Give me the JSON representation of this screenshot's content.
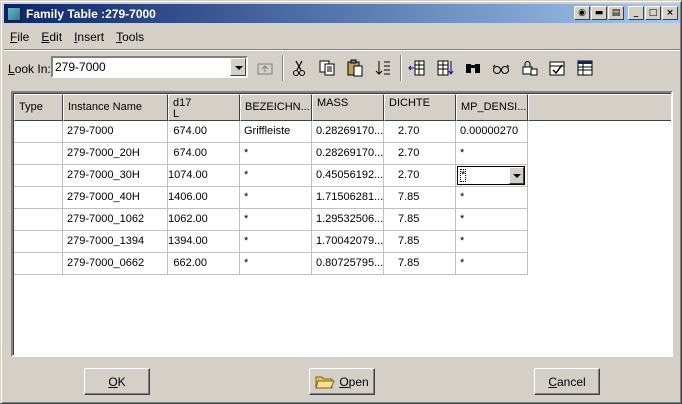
{
  "window": {
    "title": "Family Table :279-7000",
    "title_icon": "app-table-icon",
    "controls": [
      "camera-icon",
      "toolbar-icon",
      "layout-icon",
      "minimize-icon",
      "maximize-icon",
      "close-icon"
    ]
  },
  "menu": {
    "items": [
      {
        "accel": "F",
        "rest": "ile"
      },
      {
        "accel": "E",
        "rest": "dit"
      },
      {
        "accel": "I",
        "rest": "nsert"
      },
      {
        "accel": "T",
        "rest": "ools"
      }
    ]
  },
  "toolbar": {
    "look_in_accel": "L",
    "look_in_rest": "ook In:",
    "look_in_value": "279-7000",
    "icons": [
      "up-folder-icon",
      "cut-icon",
      "copy-icon",
      "paste-icon",
      "sort-icon",
      "insert-column-icon",
      "insert-row-icon",
      "find-icon",
      "preview-icon",
      "lock-icon",
      "verify-icon",
      "table-icon"
    ]
  },
  "table": {
    "headers": [
      {
        "line1": "Type",
        "line2": ""
      },
      {
        "line1": "Instance Name",
        "line2": ""
      },
      {
        "line1": "d17",
        "line2": "L"
      },
      {
        "line1": "BEZEICHN...",
        "line2": ""
      },
      {
        "line1": "MASS",
        "line2": ""
      },
      {
        "line1": "DICHTE",
        "line2": ""
      },
      {
        "line1": "MP_DENSI...",
        "line2": ""
      }
    ],
    "rows": [
      {
        "type": "",
        "name": "279-7000",
        "d17": "674.00",
        "bez": "Griffleiste",
        "mass": "0.28269170...",
        "dichte": "2.70",
        "mp": "0.00000270"
      },
      {
        "type": "",
        "name": "279-7000_20H",
        "d17": "674.00",
        "bez": "*",
        "mass": "0.28269170...",
        "dichte": "2.70",
        "mp": "*"
      },
      {
        "type": "",
        "name": "279-7000_30H",
        "d17": "1074.00",
        "bez": "*",
        "mass": "0.45056192...",
        "dichte": "2.70",
        "mp": "*"
      },
      {
        "type": "",
        "name": "279-7000_40H",
        "d17": "1406.00",
        "bez": "*",
        "mass": "1.71506281...",
        "dichte": "7.85",
        "mp": "*"
      },
      {
        "type": "",
        "name": "279-7000_1062",
        "d17": "1062.00",
        "bez": "*",
        "mass": "1.29532506...",
        "dichte": "7.85",
        "mp": "*"
      },
      {
        "type": "",
        "name": "279-7000_1394",
        "d17": "1394.00",
        "bez": "*",
        "mass": "1.70042079...",
        "dichte": "7.85",
        "mp": "*"
      },
      {
        "type": "",
        "name": "279-7000_0662",
        "d17": "662.00",
        "bez": "*",
        "mass": "0.80725795...",
        "dichte": "7.85",
        "mp": "*"
      }
    ]
  },
  "buttons": {
    "ok_accel": "O",
    "ok_rest": "K",
    "open_accel": "O",
    "open_rest": "pen",
    "cancel_accel": "C",
    "cancel_rest": "ancel"
  },
  "colors": {
    "title_start": "#0a246a",
    "title_end": "#a6caf0",
    "face": "#d4d0c8"
  }
}
